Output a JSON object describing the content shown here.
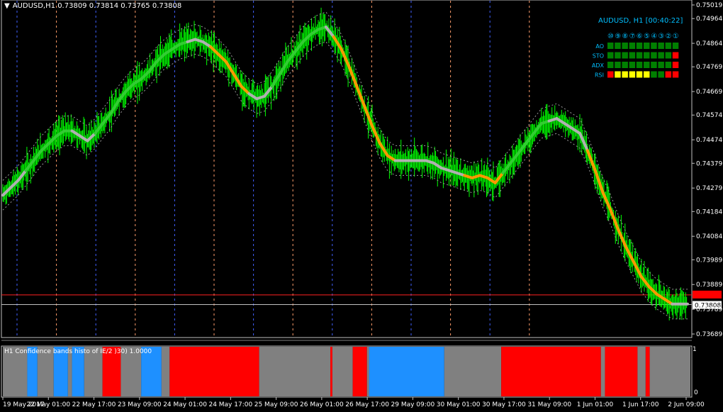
{
  "header": {
    "symbol": "AUDUSD,H1",
    "open": "0.73809",
    "high": "0.73814",
    "low": "0.73765",
    "close": "0.73808"
  },
  "dashboard": {
    "title": "AUDUSD, H1 [00:40:22]",
    "columns": [
      "⑩",
      "⑨",
      "⑧",
      "⑦",
      "⑥",
      "⑤",
      "④",
      "③",
      "②",
      "①"
    ],
    "rows": [
      {
        "label": "AO",
        "cells": [
          "g",
          "g",
          "g",
          "g",
          "g",
          "g",
          "g",
          "g",
          "g",
          "g"
        ]
      },
      {
        "label": "STO",
        "cells": [
          "g",
          "g",
          "g",
          "g",
          "g",
          "g",
          "g",
          "g",
          "g",
          "r"
        ]
      },
      {
        "label": "ADX",
        "cells": [
          "g",
          "g",
          "g",
          "g",
          "g",
          "g",
          "g",
          "g",
          "g",
          "r"
        ]
      },
      {
        "label": "RSI",
        "cells": [
          "r",
          "y",
          "y",
          "y",
          "y",
          "y",
          "g",
          "g",
          "r",
          "r"
        ]
      }
    ]
  },
  "price_axis": {
    "labels": [
      "0.75019",
      "0.74964",
      "0.74864",
      "0.74769",
      "0.74669",
      "0.74574",
      "0.74474",
      "0.74379",
      "0.74279",
      "0.74184",
      "0.74084",
      "0.73989",
      "0.73889",
      "0.73789",
      "0.73689"
    ],
    "current_price": "0.73808",
    "red_line_price": "0.73847"
  },
  "time_axis": {
    "labels": [
      "19 May 2017",
      "22 May 01:00",
      "22 May 17:00",
      "23 May 09:00",
      "24 May 01:00",
      "24 May 17:00",
      "25 May 09:00",
      "26 May 01:00",
      "26 May 17:00",
      "29 May 09:00",
      "30 May 01:00",
      "30 May 17:00",
      "31 May 09:00",
      "1 Jun 01:00",
      "1 Jun 17:00",
      "2 Jun 09:00"
    ]
  },
  "indicator": {
    "title": "H1 Confidence bands histo of  IE/2 )30) 1.0000",
    "scale_max": "1",
    "scale_min": "0",
    "segments": [
      {
        "state": "gray",
        "from": 0,
        "to": 0.12
      },
      {
        "state": "blue",
        "from": 0.12,
        "to": 0.17
      },
      {
        "state": "gray",
        "from": 0.17,
        "to": 0.25
      },
      {
        "state": "blue",
        "from": 0.25,
        "to": 0.32
      },
      {
        "state": "gray",
        "from": 0.32,
        "to": 0.34
      },
      {
        "state": "blue",
        "from": 0.34,
        "to": 0.4
      },
      {
        "state": "gray",
        "from": 0.4,
        "to": 0.49
      },
      {
        "state": "red",
        "from": 0.49,
        "to": 0.58
      },
      {
        "state": "gray",
        "from": 0.58,
        "to": 0.68
      },
      {
        "state": "blue",
        "from": 0.68,
        "to": 0.78
      },
      {
        "state": "gray",
        "from": 0.78,
        "to": 0.82
      },
      {
        "state": "red",
        "from": 0.82,
        "to": 1.26
      },
      {
        "state": "gray",
        "from": 1.26,
        "to": 1.61
      },
      {
        "state": "red",
        "from": 1.61,
        "to": 1.62
      },
      {
        "state": "gray",
        "from": 1.62,
        "to": 1.72
      },
      {
        "state": "red",
        "from": 1.72,
        "to": 1.79
      },
      {
        "state": "gray",
        "from": 1.79,
        "to": 1.8
      },
      {
        "state": "blue",
        "from": 1.8,
        "to": 2.17
      },
      {
        "state": "gray",
        "from": 2.17,
        "to": 2.45
      },
      {
        "state": "red",
        "from": 2.45,
        "to": 2.94
      },
      {
        "state": "gray",
        "from": 2.94,
        "to": 2.96
      },
      {
        "state": "red",
        "from": 2.96,
        "to": 3.12
      },
      {
        "state": "gray",
        "from": 3.12,
        "to": 3.16
      },
      {
        "state": "red",
        "from": 3.16,
        "to": 3.18
      },
      {
        "state": "gray",
        "from": 3.18,
        "to": 3.38
      }
    ]
  },
  "series": {
    "closes": [
      0.7425,
      0.7428,
      0.7431,
      0.7435,
      0.7439,
      0.7443,
      0.7446,
      0.7449,
      0.7451,
      0.7451,
      0.7449,
      0.7447,
      0.745,
      0.7454,
      0.7458,
      0.7463,
      0.7467,
      0.747,
      0.7472,
      0.7475,
      0.7479,
      0.7482,
      0.7484,
      0.7486,
      0.7487,
      0.7488,
      0.7487,
      0.7485,
      0.7482,
      0.7479,
      0.7474,
      0.7469,
      0.7466,
      0.7464,
      0.7465,
      0.7469,
      0.7474,
      0.7479,
      0.7483,
      0.7487,
      0.749,
      0.7492,
      0.7493,
      0.7489,
      0.7484,
      0.7477,
      0.7469,
      0.7461,
      0.7453,
      0.7446,
      0.7441,
      0.7439,
      0.7439,
      0.7439,
      0.7439,
      0.7439,
      0.7438,
      0.7436,
      0.7435,
      0.7434,
      0.7433,
      0.7432,
      0.7433,
      0.7432,
      0.743,
      0.7434,
      0.7438,
      0.7442,
      0.7446,
      0.745,
      0.7454,
      0.7455,
      0.7456,
      0.7454,
      0.7452,
      0.745,
      0.7443,
      0.7435,
      0.7426,
      0.7419,
      0.7411,
      0.7404,
      0.7398,
      0.7392,
      0.7388,
      0.7385,
      0.7383,
      0.7381,
      0.7381,
      0.7381
    ],
    "state": [
      "x",
      "x",
      "x",
      "g",
      "g",
      "g",
      "g",
      "g",
      "g",
      "x",
      "x",
      "x",
      "g",
      "g",
      "g",
      "g",
      "g",
      "g",
      "g",
      "g",
      "g",
      "g",
      "g",
      "g",
      "x",
      "x",
      "x",
      "o",
      "o",
      "o",
      "o",
      "o",
      "x",
      "x",
      "x",
      "g",
      "g",
      "g",
      "g",
      "g",
      "g",
      "g",
      "x",
      "o",
      "o",
      "o",
      "o",
      "o",
      "o",
      "o",
      "o",
      "x",
      "x",
      "x",
      "x",
      "x",
      "x",
      "x",
      "x",
      "x",
      "o",
      "o",
      "o",
      "o",
      "o",
      "g",
      "g",
      "g",
      "g",
      "g",
      "g",
      "x",
      "x",
      "x",
      "x",
      "x",
      "o",
      "o",
      "o",
      "o",
      "o",
      "o",
      "o",
      "o",
      "o",
      "o",
      "o",
      "x",
      "x",
      "x"
    ]
  }
}
